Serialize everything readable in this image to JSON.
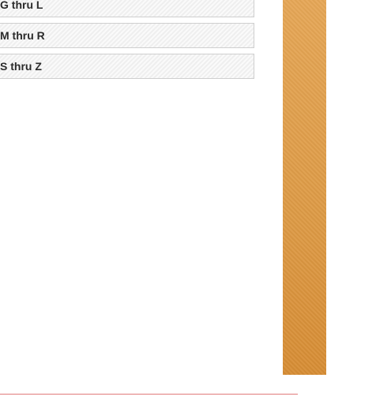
{
  "accordion": {
    "items": [
      {
        "label": "G thru L"
      },
      {
        "label": "M thru R"
      },
      {
        "label": "S thru Z"
      }
    ]
  },
  "colors": {
    "sidebar_accent": "#e0a050",
    "divider": "#e07a7a",
    "item_background": "#f4f4f4",
    "item_border": "#cfcfcf"
  }
}
